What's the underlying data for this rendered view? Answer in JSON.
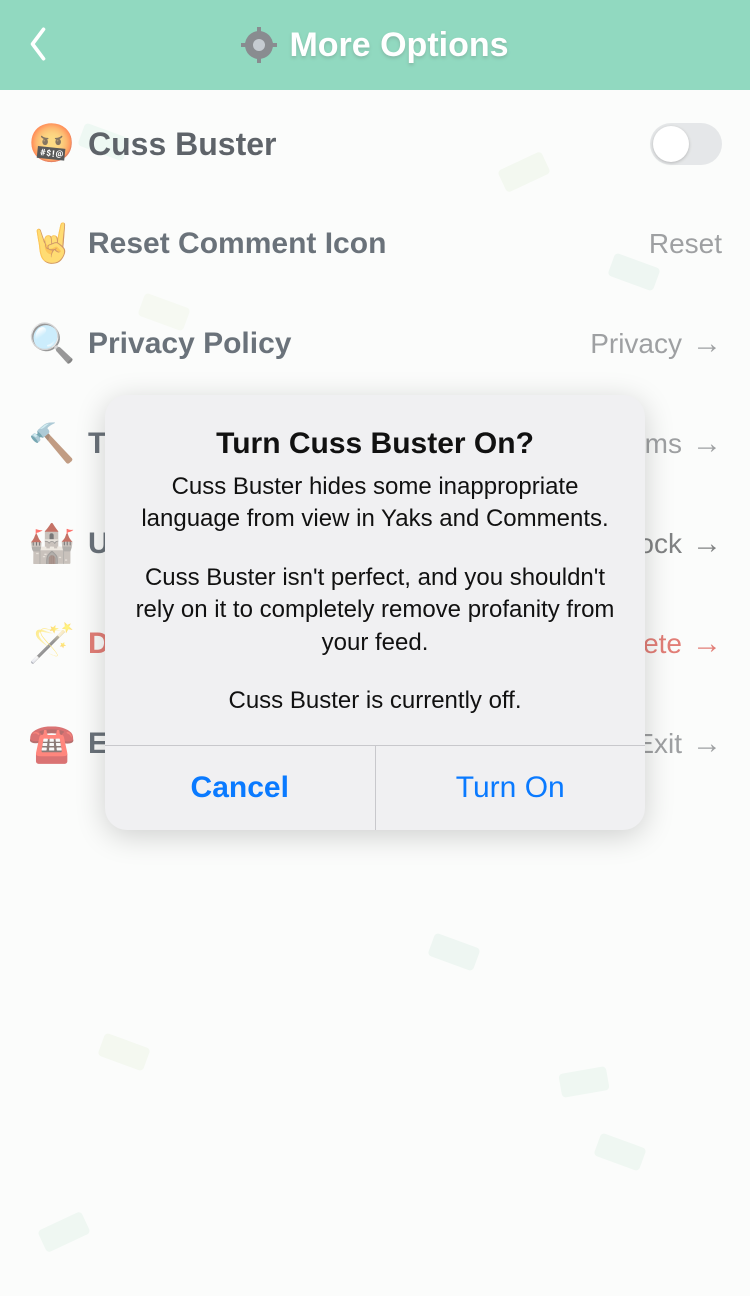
{
  "header": {
    "title": "More Options"
  },
  "rows": {
    "cuss_buster": {
      "icon": "🤬",
      "label": "Cuss Buster"
    },
    "reset_comment": {
      "icon": "🤘",
      "label": "Reset Comment Icon",
      "action": "Reset"
    },
    "privacy": {
      "icon": "🔍",
      "label": "Privacy Policy",
      "action": "Privacy"
    },
    "terms": {
      "icon": "🔨",
      "label": "Terms of Service",
      "action": "Terms"
    },
    "block_unblock": {
      "icon": "🏰",
      "label": "Unblock Users",
      "action": "Block"
    },
    "delete_account": {
      "icon": "🪄",
      "label": "Delete",
      "action": "Delete"
    },
    "exit": {
      "icon": "☎️",
      "label": "Exit",
      "action": "Exit"
    }
  },
  "dialog": {
    "title": "Turn Cuss Buster On?",
    "p1": "Cuss Buster hides some inappropriate language from view in Yaks and Comments.",
    "p2": "Cuss Buster isn't perfect, and you shouldn't rely on it to completely remove profanity from your feed.",
    "p3": "Cuss Buster is currently off.",
    "cancel": "Cancel",
    "confirm": "Turn On"
  }
}
